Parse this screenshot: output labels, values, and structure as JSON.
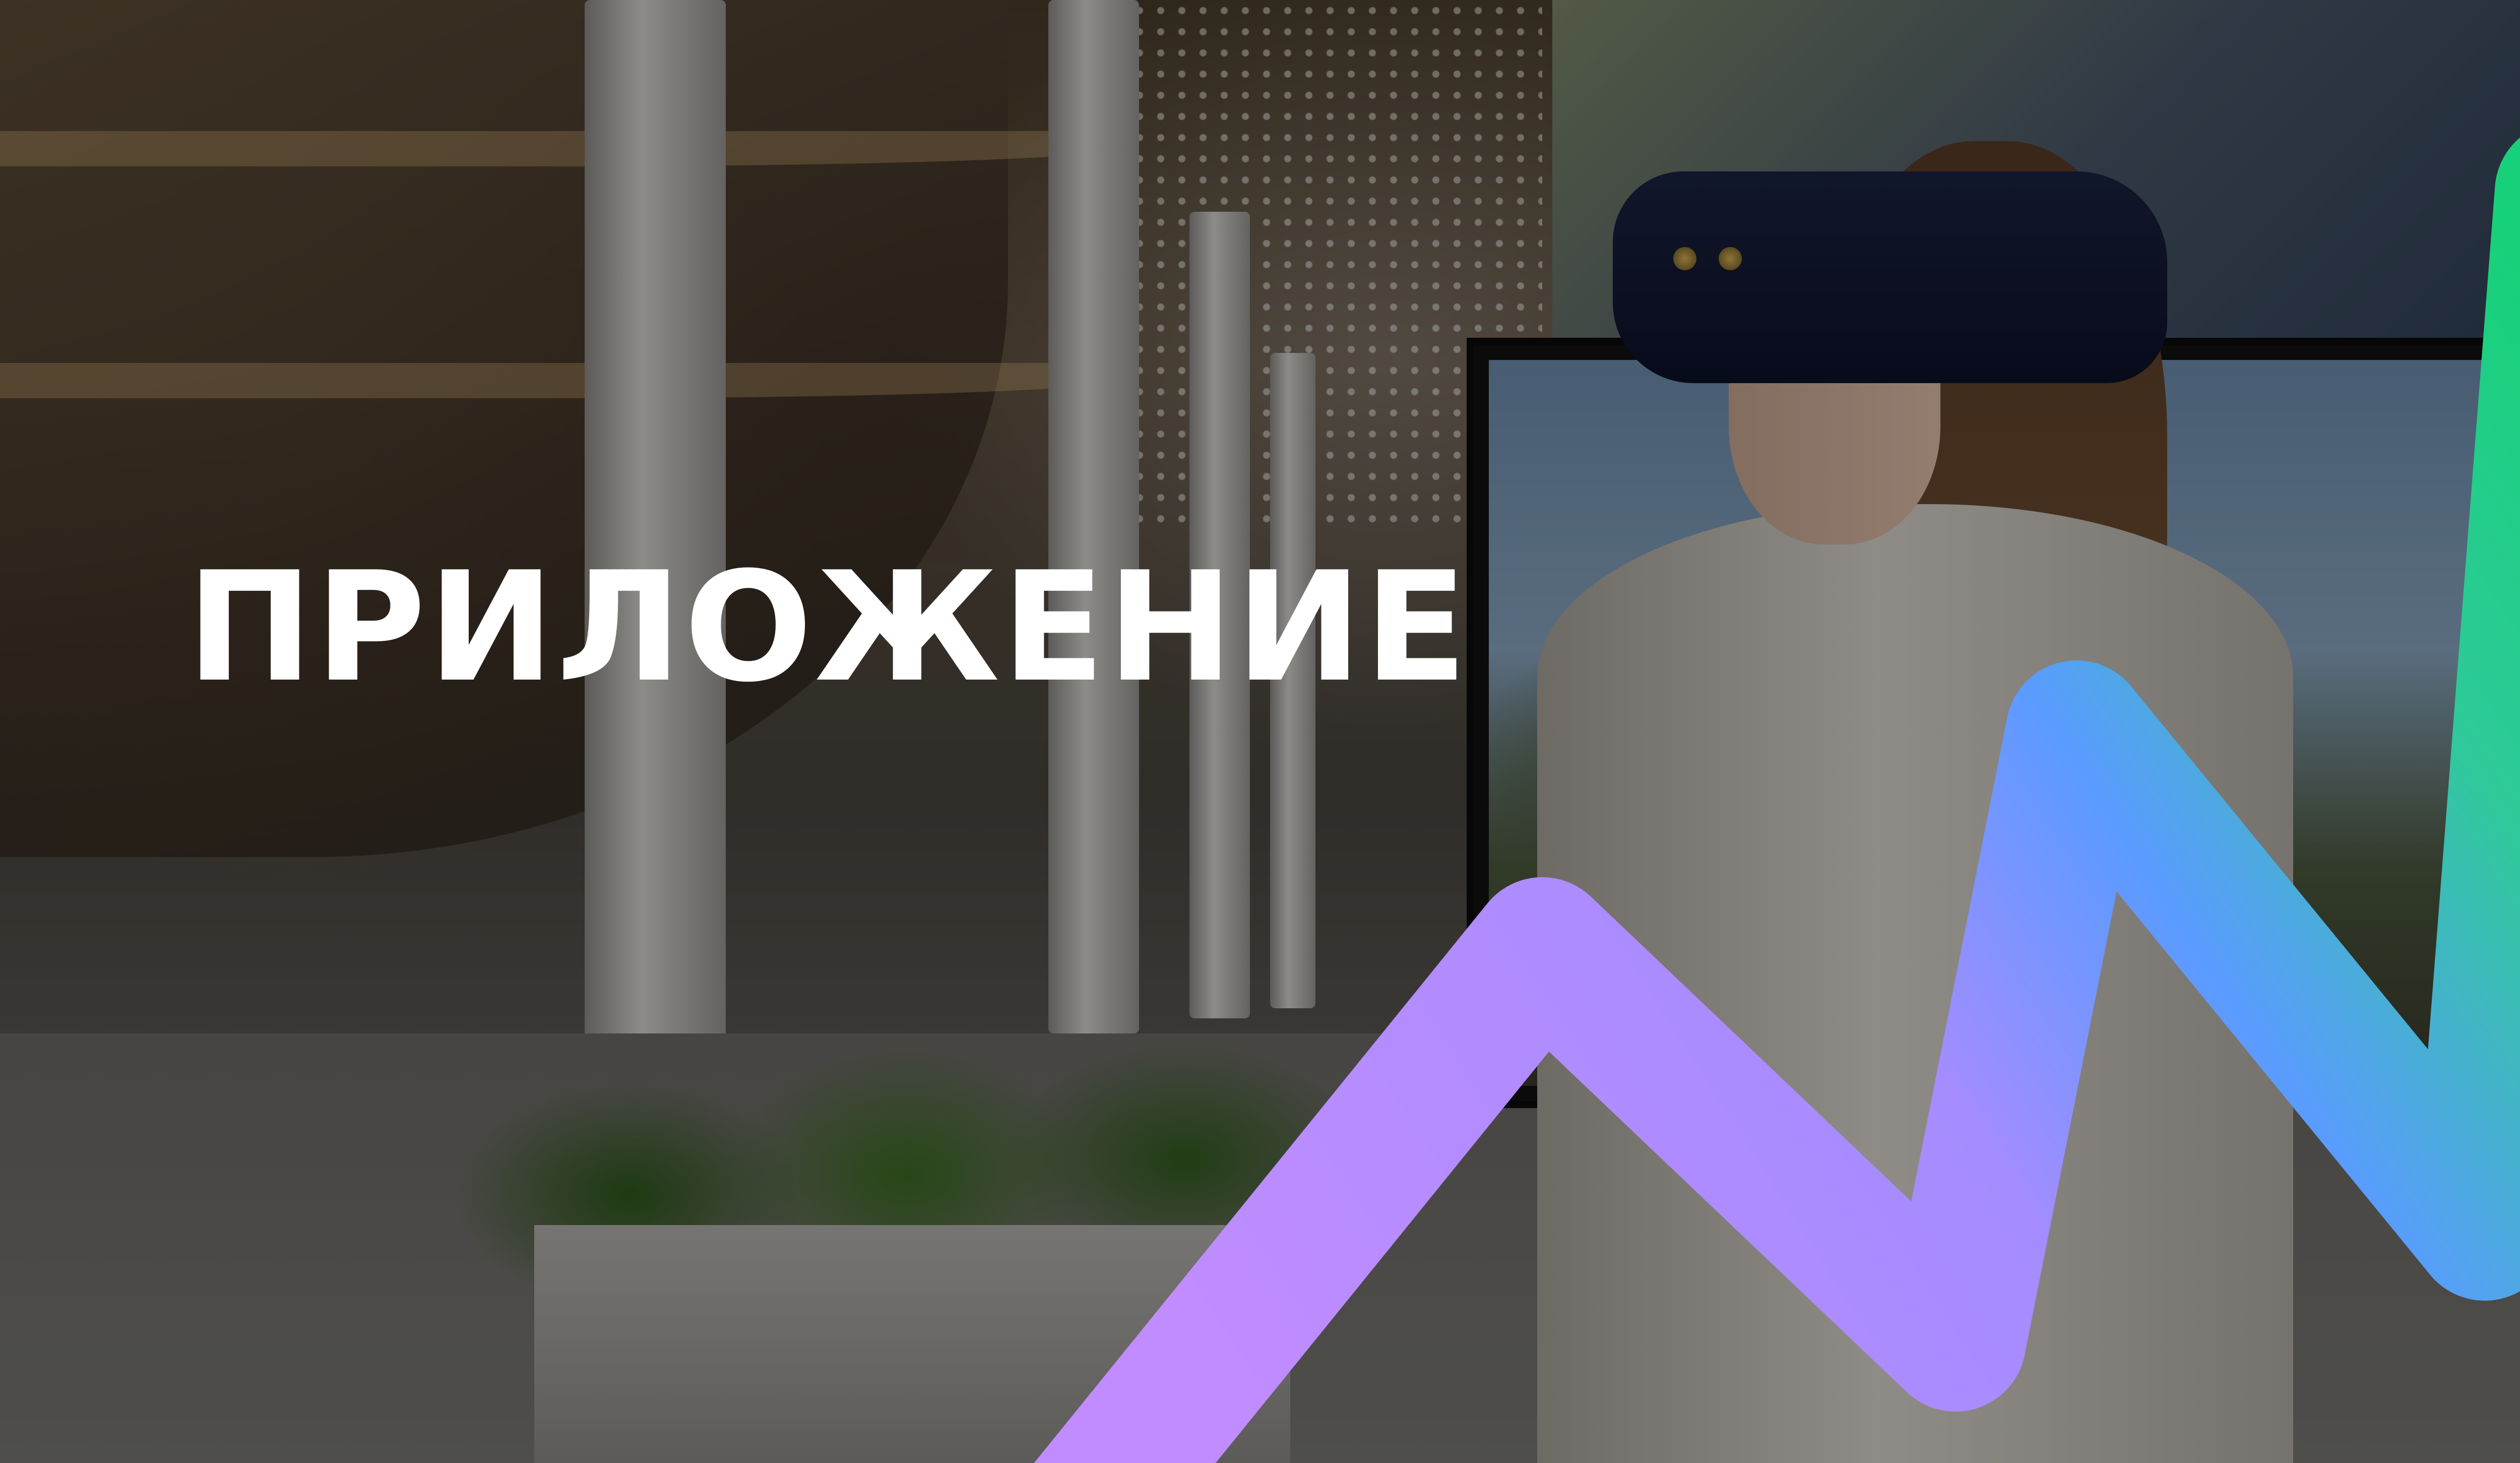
{
  "headline": "ПРИЛОЖЕНИЕ",
  "colors": {
    "headline_text": "#ffffff",
    "brand_gradient_start": "#c08cff",
    "brand_gradient_mid": "#5a9bff",
    "brand_gradient_end": "#17d17a"
  },
  "icons": {
    "brand_shape": "zigzag-logo-icon"
  }
}
